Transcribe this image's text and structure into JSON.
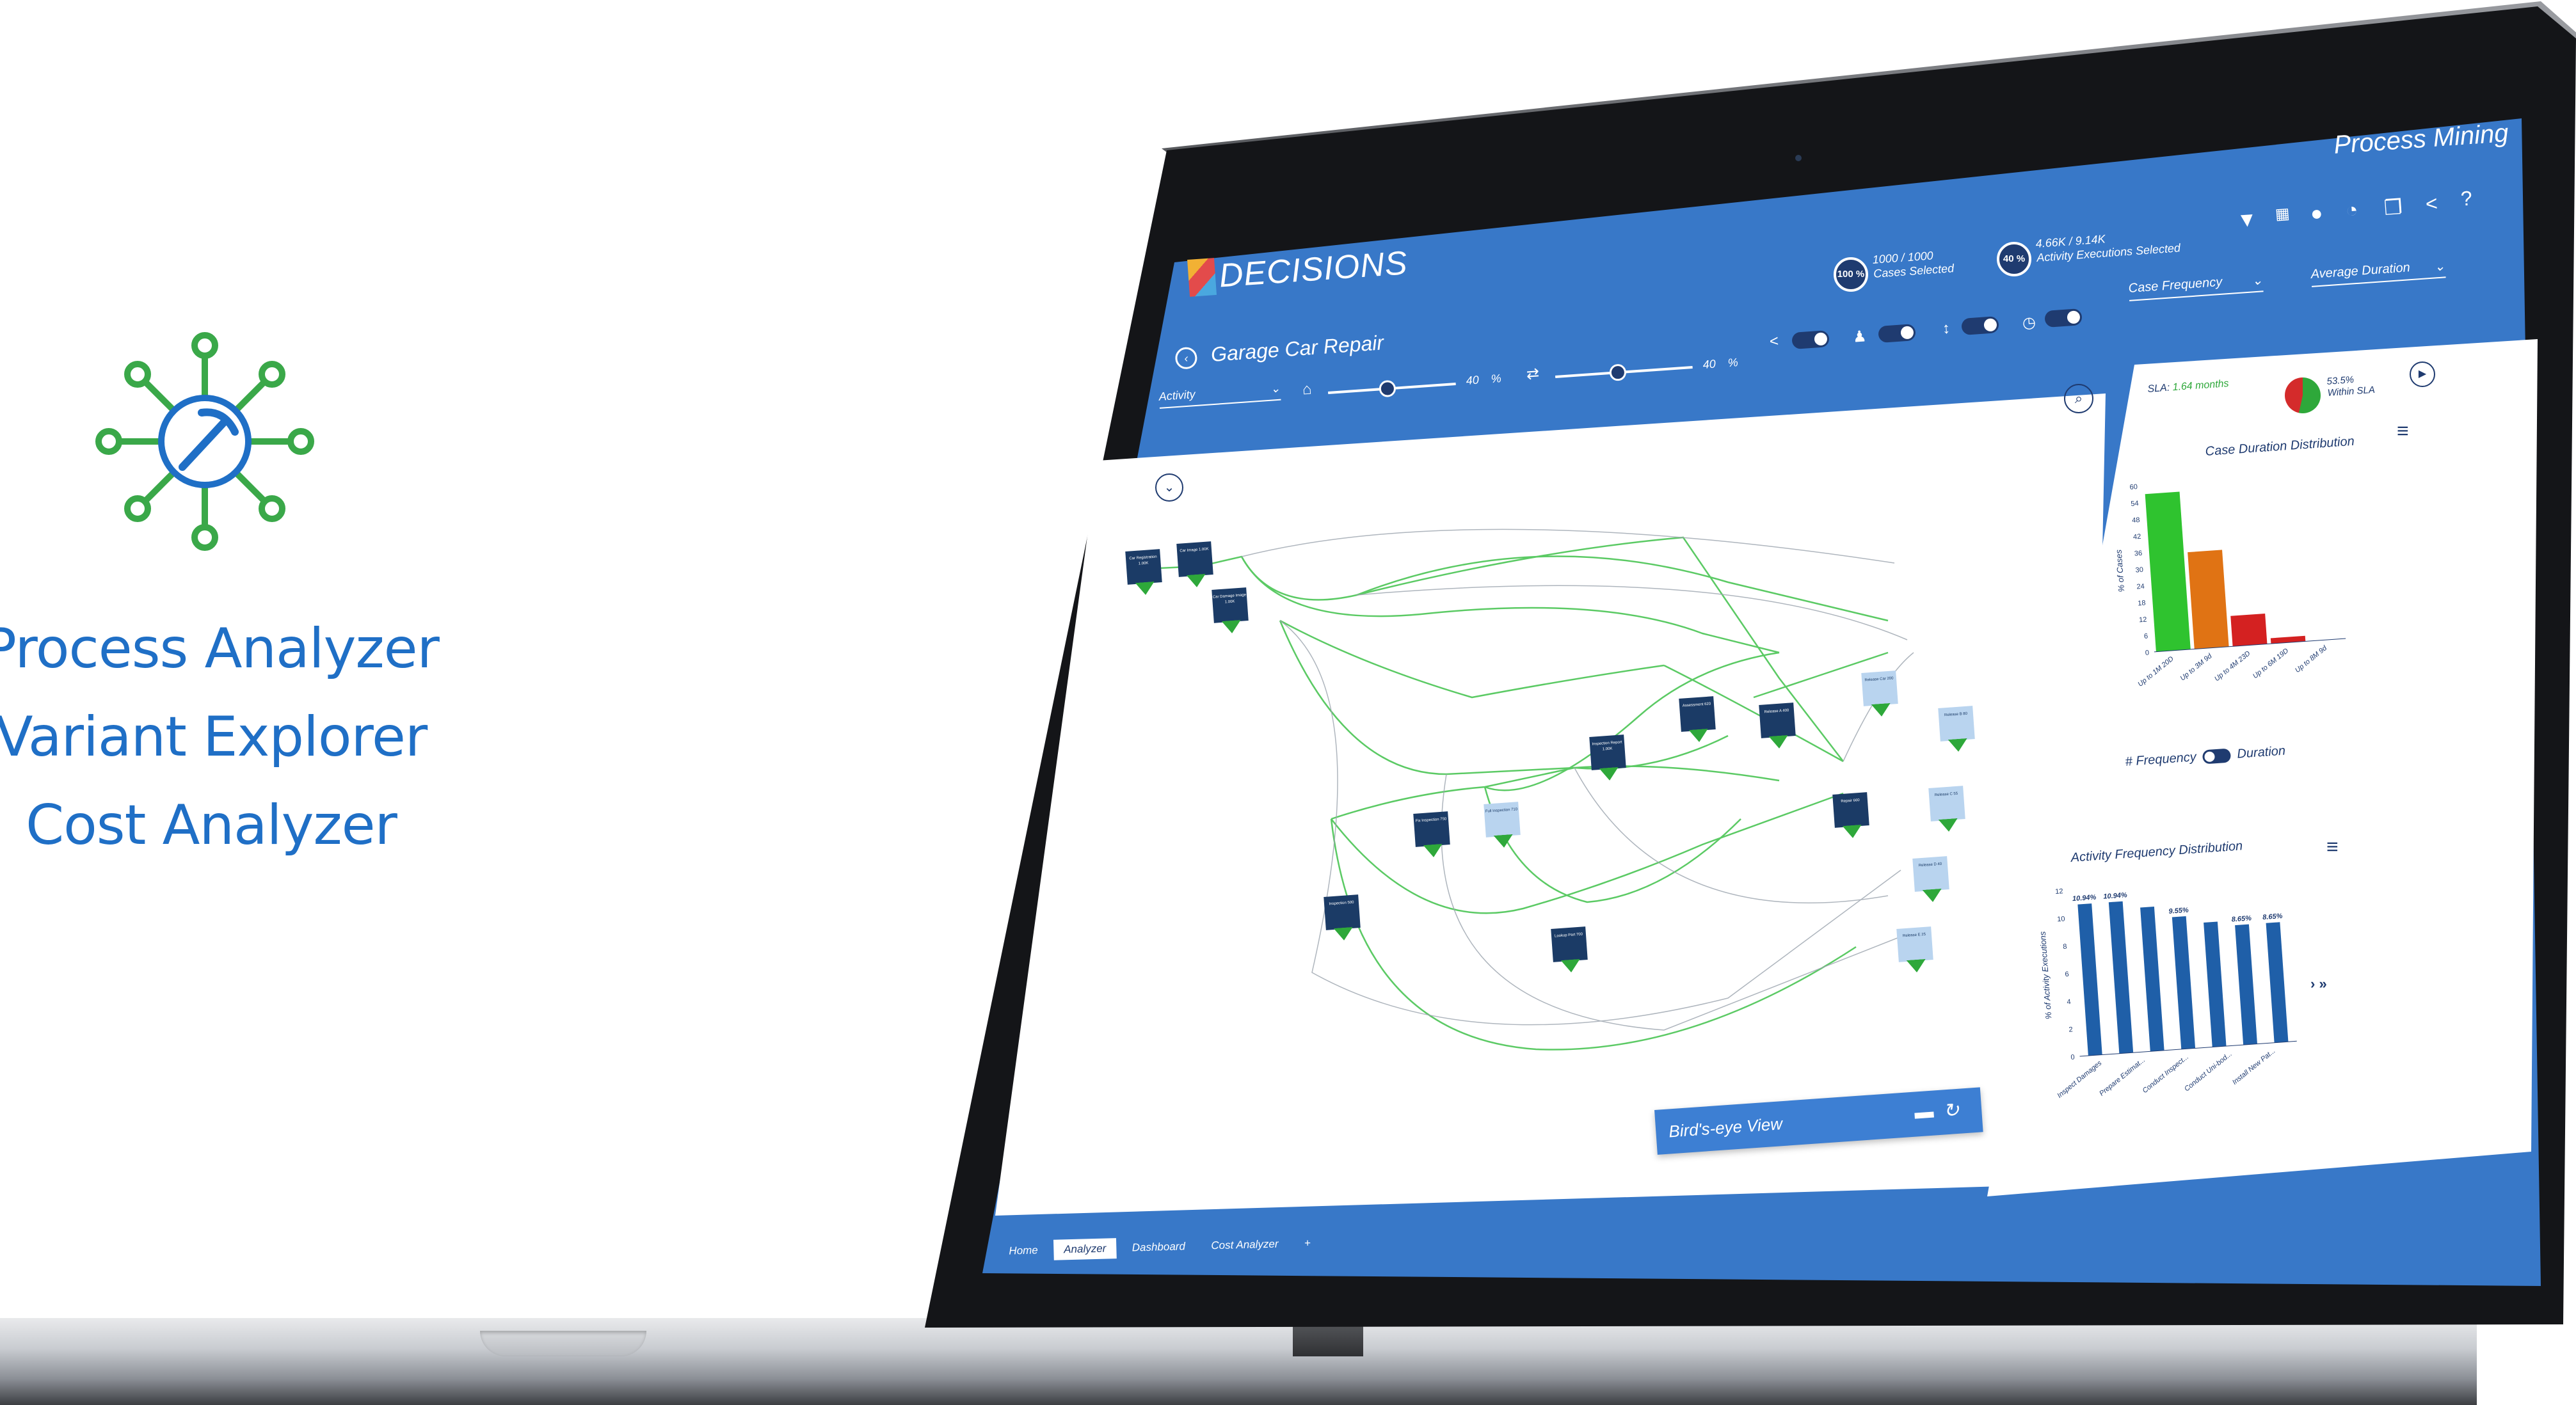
{
  "features": {
    "items": [
      "Process Analyzer",
      "Variant Explorer",
      "Cost Analyzer"
    ],
    "icon": "process-mining-pickaxe-icon",
    "accent_color": "#1f6fc6",
    "icon_color": "#3aa849"
  },
  "app": {
    "brand": "DECISIONS",
    "title": "Process Mining",
    "page_title": "Garage Car Repair",
    "activity_select": "Activity",
    "cases": {
      "badge": "100 %",
      "count": "1000 / 1000",
      "label": "Cases Selected"
    },
    "executions": {
      "badge": "40 %",
      "count": "4.66K / 9.14K",
      "label": "Activity Executions Selected"
    },
    "slider1_value": "40",
    "slider1_unit": "%",
    "slider2_value": "40",
    "slider2_unit": "%",
    "dropdown_frequency": "Case Frequency",
    "dropdown_duration": "Average Duration",
    "birds_eye_label": "Bird's-eye View",
    "header_color": "#3878c8",
    "header_dark": "#1f3b70"
  },
  "tabs": [
    {
      "label": "Home",
      "active": false
    },
    {
      "label": "Analyzer",
      "active": true
    },
    {
      "label": "Dashboard",
      "active": false
    },
    {
      "label": "Cost Analyzer",
      "active": false
    },
    {
      "label": "+",
      "active": false
    }
  ],
  "sla": {
    "label": "SLA:",
    "value": "1.64 months",
    "pct": "53.5%",
    "pct_label": "Within SLA",
    "within_fraction": 0.535
  },
  "toggle_labels": {
    "left": "# Frequency",
    "right": "Duration"
  },
  "process_map": {
    "nodes": [
      "Car Registration 1.00K",
      "Car Image 1.00K",
      "Car Damage Image 1.00K",
      "Inspection 500",
      "Fix Inspection 750",
      "Full Inspection 710",
      "Inspection Report 1.00K",
      "Lookup Part 700",
      "Assessment 620",
      "Release A 400",
      "Release Car 200",
      "Repair 660",
      "Case 1.00K",
      "Release B 80",
      "Release C 55",
      "Release D 40",
      "Release E 25"
    ]
  },
  "chart_data": [
    {
      "type": "bar",
      "title": "Case Duration Distribution",
      "ylabel": "% of Cases",
      "xlabel": "",
      "categories": [
        "Up to 1M 20D",
        "Up to 3M 9d",
        "Up to 4M 23D",
        "Up to 6M 19D",
        "Up to 8M 9d"
      ],
      "values": [
        57,
        35,
        11,
        2,
        0
      ],
      "colors": [
        "#2fc32f",
        "#e07314",
        "#d42121",
        "#d42121",
        "#d42121"
      ],
      "yticks": [
        0,
        6,
        12,
        18,
        24,
        30,
        36,
        42,
        48,
        54,
        60
      ],
      "ylim": [
        0,
        60
      ]
    },
    {
      "type": "bar",
      "title": "Activity Frequency Distribution",
      "ylabel": "% of Activity Executions",
      "xlabel": "",
      "categories": [
        "Inspect Damages",
        "Prepare Estimat...",
        "Conduct Inspect...",
        "Conduct Uni-bod...",
        "Install New Pat..."
      ],
      "values": [
        10.94,
        10.94,
        10.4,
        9.55,
        9.0,
        8.65,
        8.65
      ],
      "data_labels": [
        "10.94%",
        "10.94%",
        "",
        "9.55%",
        "",
        "8.65%",
        "8.65%"
      ],
      "colors": [
        "#1f5fa8"
      ],
      "yticks": [
        0,
        2,
        4,
        6,
        8,
        10,
        12
      ],
      "ylim": [
        0,
        12
      ]
    }
  ]
}
